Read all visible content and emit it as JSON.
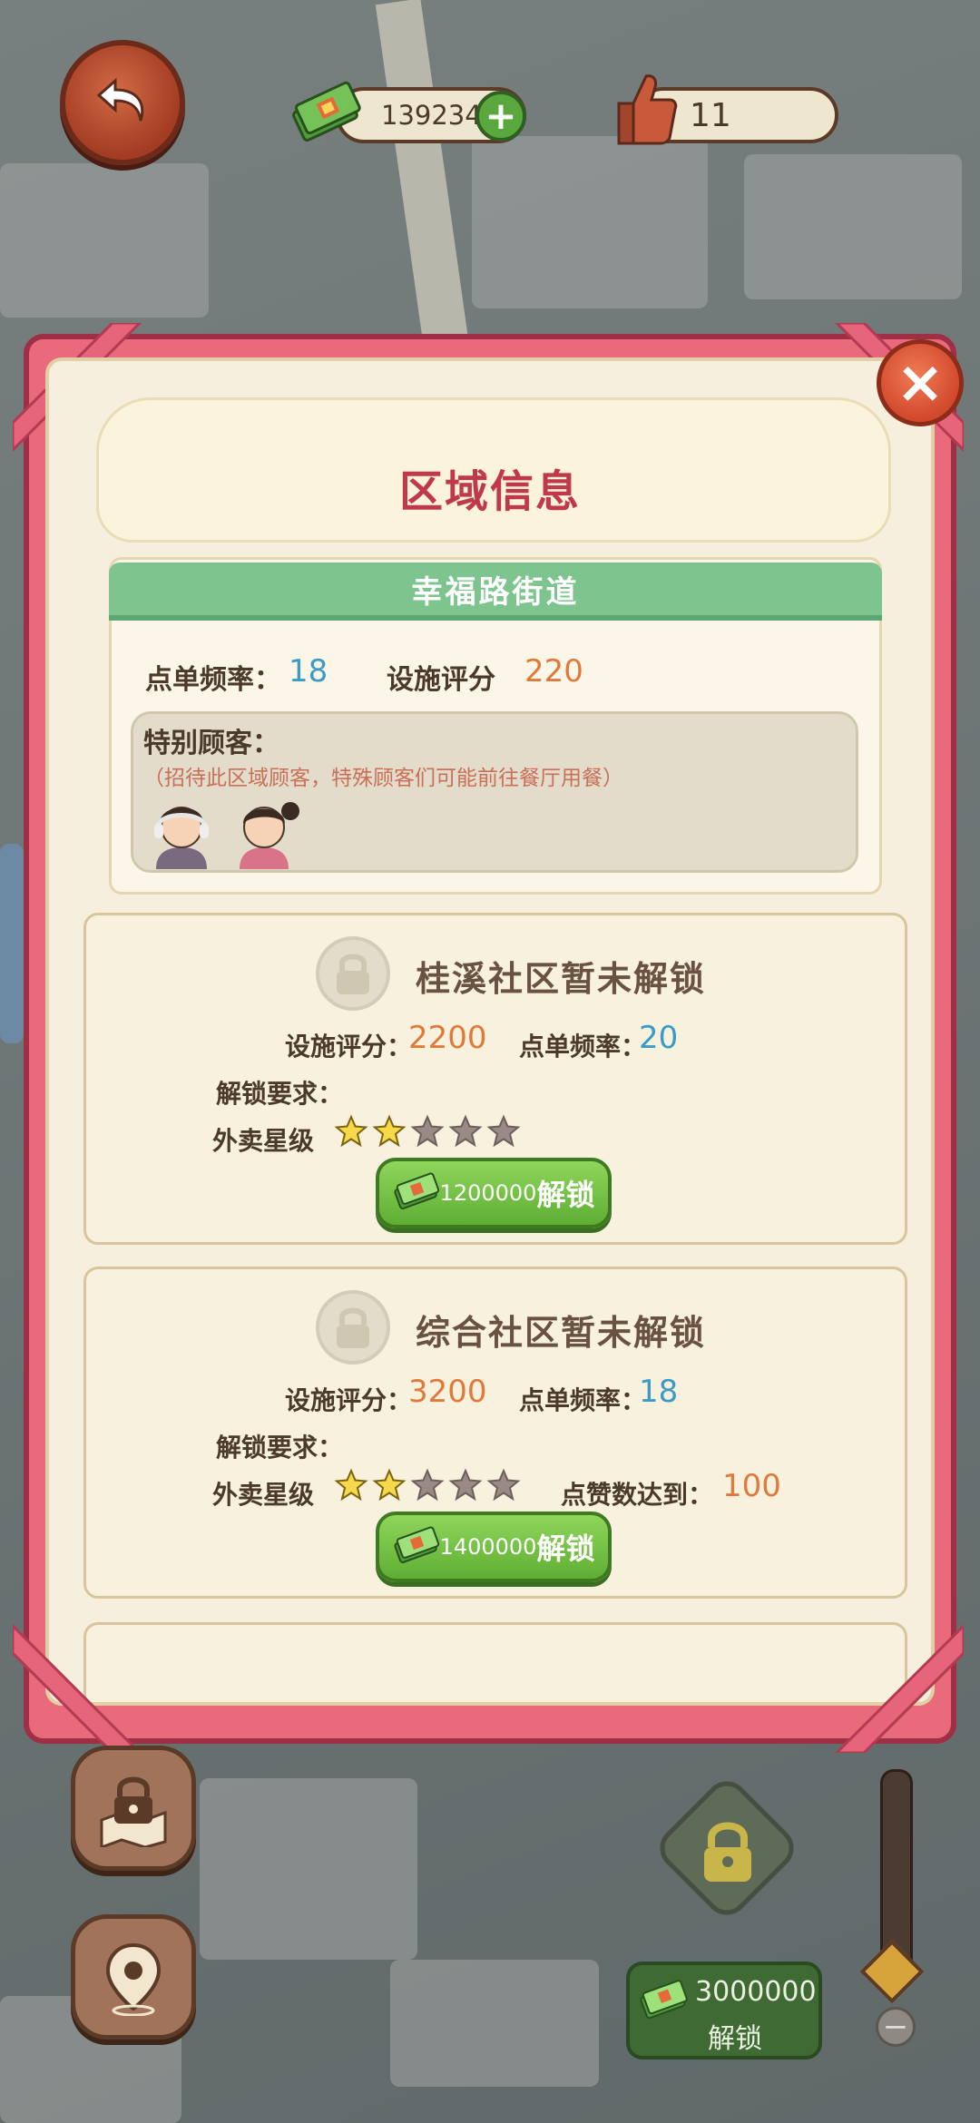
{
  "topbar": {
    "money": "1392342",
    "likes": "11"
  },
  "modal": {
    "title": "区域信息",
    "street": {
      "name": "幸福路街道",
      "order_rate_label": "点单频率：",
      "order_rate_value": "18",
      "rating_label": "设施评分",
      "rating_value": "220",
      "special_customers_label": "特别顾客：",
      "special_customers_note": "（招待此区域顾客，特殊顾客们可能前往餐厅用餐）"
    },
    "areas": [
      {
        "title": "桂溪社区暂未解锁",
        "rating_label": "设施评分：",
        "rating_value": "2200",
        "order_rate_label": "点单频率：",
        "order_rate_value": "20",
        "requirements_label": "解锁要求：",
        "stars_label": "外卖星级",
        "stars_filled": 2,
        "stars_total": 5,
        "likes_label": "",
        "likes_value": "",
        "cost": "1200000",
        "button_label": "解锁"
      },
      {
        "title": "综合社区暂未解锁",
        "rating_label": "设施评分：",
        "rating_value": "3200",
        "order_rate_label": "点单频率：",
        "order_rate_value": "18",
        "requirements_label": "解锁要求：",
        "stars_label": "外卖星级",
        "stars_filled": 2,
        "stars_total": 5,
        "likes_label": "点赞数达到：",
        "likes_value": "100",
        "cost": "1400000",
        "button_label": "解锁"
      }
    ]
  },
  "bottom": {
    "buy_cost": "3000000",
    "buy_label": "解锁"
  },
  "colors": {
    "frame": "#e86a7b",
    "title": "#c0394a",
    "street_header": "#7dc48e",
    "green_button": "#5fae34",
    "blue_value": "#3a9bc6",
    "orange_value": "#e07a3a"
  },
  "icons": [
    "back-arrow-icon",
    "money-icon",
    "plus-icon",
    "thumbs-up-icon",
    "close-icon",
    "lock-icon",
    "map-lock-icon",
    "location-pin-icon",
    "star-icon",
    "minus-icon"
  ]
}
